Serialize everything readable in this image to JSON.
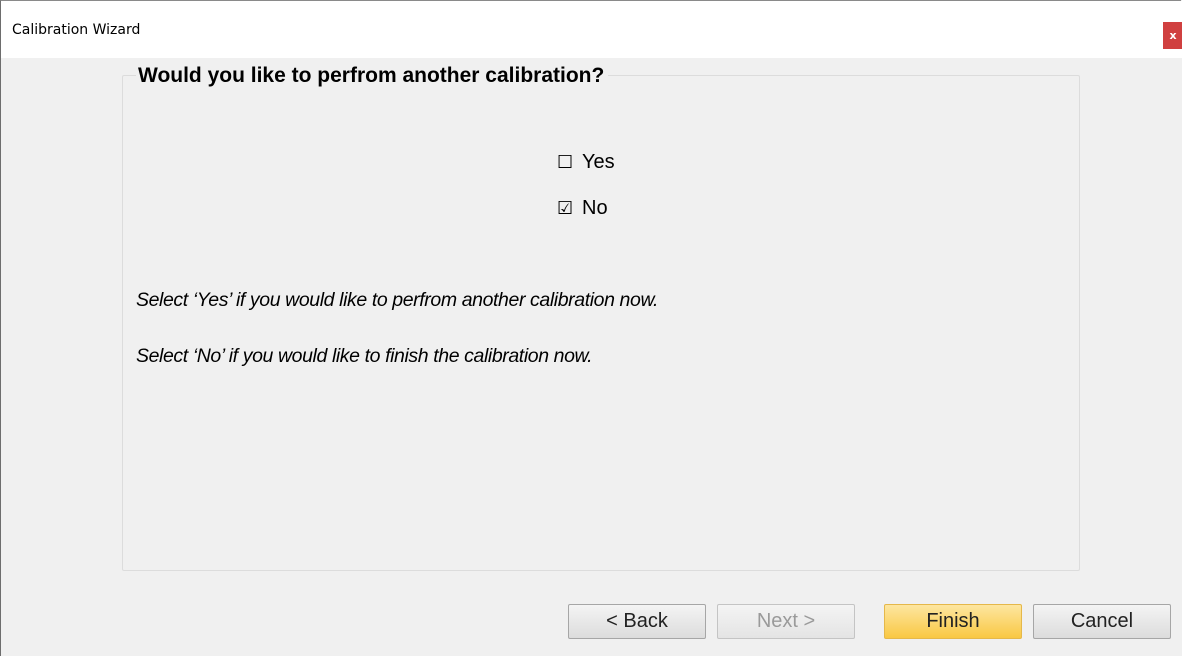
{
  "window": {
    "title": "Calibration Wizard",
    "close_label": "x"
  },
  "group": {
    "legend": "Would you like to perfrom another calibration?"
  },
  "options": {
    "yes": {
      "box": "☐",
      "label": "Yes",
      "checked": false
    },
    "no": {
      "box": "☑",
      "label": "No",
      "checked": true
    }
  },
  "descriptions": {
    "line1": "Select ‘Yes’ if you would like to perfrom another calibration now.",
    "line2": "Select ‘No’ if you would like to finish the calibration now."
  },
  "buttons": {
    "back": "< Back",
    "next": "Next >",
    "finish": "Finish",
    "cancel": "Cancel"
  },
  "colors": {
    "finish_accent": "#f9c843",
    "close_button": "#d04040"
  }
}
